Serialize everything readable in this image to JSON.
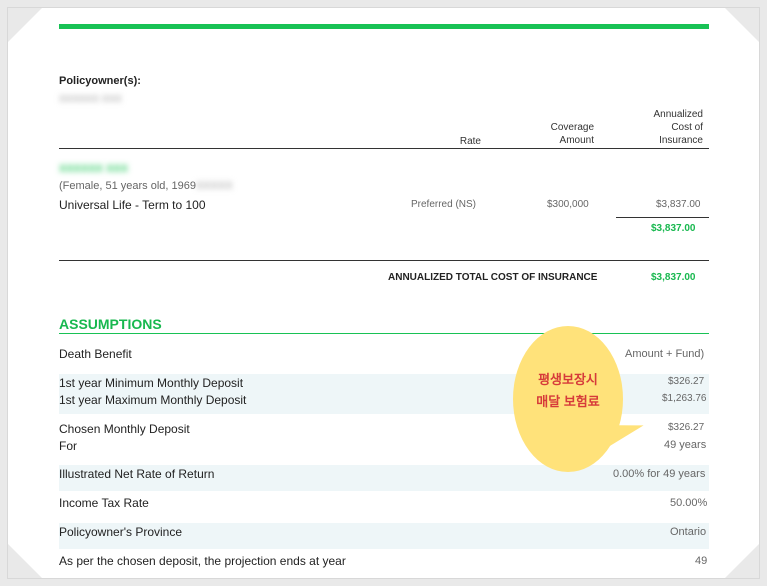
{
  "policyowner_label": "Policyowner(s):",
  "policyowner_name": "XXXXXX XXX",
  "columns": {
    "rate": "Rate",
    "coverage": "Coverage\nAmount",
    "annualized": "Annualized\nCost of\nInsurance"
  },
  "insured": {
    "name": "XXXXXX XXX",
    "details": "(Female, 51 years old, 1969",
    "details_hidden": "XXXXX",
    "plan": "Universal Life - Term to 100",
    "rate": "Preferred (NS)",
    "coverage": "$300,000",
    "cost": "$3,837.00",
    "subtotal": "$3,837.00"
  },
  "total": {
    "label": "ANNUALIZED TOTAL COST OF INSURANCE",
    "value": "$3,837.00"
  },
  "assumptions": {
    "title": "ASSUMPTIONS",
    "rows": [
      {
        "label": "Death Benefit",
        "value": "Amount + Fund)"
      },
      {
        "label": "1st year Minimum Monthly Deposit",
        "value": "$326.27"
      },
      {
        "label": "1st year Maximum Monthly Deposit",
        "value": "$1,263.76"
      },
      {
        "label": "Chosen Monthly Deposit",
        "value": "$326.27"
      },
      {
        "label": "For",
        "value": "49 years"
      },
      {
        "label": "Illustrated Net Rate of Return",
        "value": "0.00% for 49 years"
      },
      {
        "label": "Income Tax Rate",
        "value": "50.00%"
      },
      {
        "label": "Policyowner's Province",
        "value": "Ontario"
      },
      {
        "label": "As per the chosen deposit, the projection ends at year",
        "value": "49"
      }
    ]
  },
  "annotation": {
    "line1": "평생보장시",
    "line2": "매달 보험료"
  }
}
